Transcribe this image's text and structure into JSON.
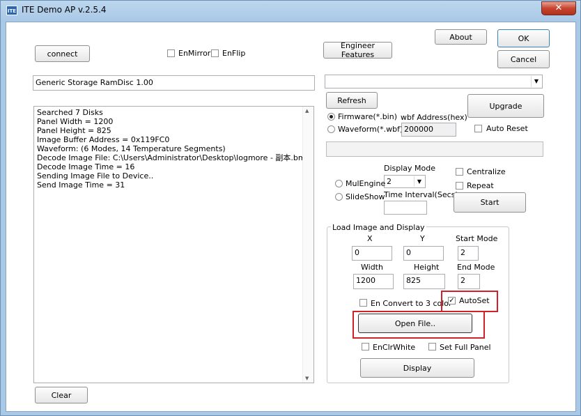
{
  "window": {
    "title": "ITE Demo AP v.2.5.4",
    "app_icon_text": "ITE",
    "close_glyph": "✕"
  },
  "buttons": {
    "connect": "connect",
    "engineer_features": "Engineer Features",
    "about": "About",
    "ok": "OK",
    "cancel": "Cancel",
    "refresh": "Refresh",
    "upgrade": "Upgrade",
    "start": "Start",
    "open_file": "Open File..",
    "display": "Display",
    "clear": "Clear"
  },
  "checkboxes": {
    "en_mirror": {
      "label": "EnMirror",
      "checked": false
    },
    "en_flip": {
      "label": "EnFlip",
      "checked": false
    },
    "auto_reset": {
      "label": "Auto Reset",
      "checked": false
    },
    "centralize": {
      "label": "Centralize",
      "checked": false
    },
    "repeat": {
      "label": "Repeat",
      "checked": false
    },
    "en_convert": {
      "label": "En Convert to 3 color",
      "checked": false
    },
    "autoset": {
      "label": "AutoSet",
      "checked": true
    },
    "en_clr_white": {
      "label": "EnClrWhite",
      "checked": false
    },
    "set_full_panel": {
      "label": "Set Full Panel",
      "checked": false
    }
  },
  "radios": {
    "firmware": {
      "label": "Firmware(*.bin)",
      "selected": true
    },
    "waveform": {
      "label": "Waveform(*.wbf)",
      "selected": false
    },
    "mul_engine": {
      "label": "MulEngine",
      "selected": false
    },
    "slide_show": {
      "label": "SlideShow",
      "selected": false
    }
  },
  "device_field": "Generic Storage RamDisc 1.00",
  "firmware_combo": "",
  "wbf_address": {
    "label": "wbf Address(hex)",
    "value": "200000"
  },
  "display_mode": {
    "label": "Display Mode",
    "value": "2"
  },
  "time_interval": {
    "label": "Time Interval(Secs)",
    "value": ""
  },
  "load_group": {
    "title": "Load Image and Display",
    "x": {
      "label": "X",
      "value": "0"
    },
    "y": {
      "label": "Y",
      "value": "0"
    },
    "start_mode": {
      "label": "Start Mode",
      "value": "2"
    },
    "width": {
      "label": "Width",
      "value": "1200"
    },
    "height": {
      "label": "Height",
      "value": "825"
    },
    "end_mode": {
      "label": "End Mode",
      "value": "2"
    }
  },
  "log_lines": [
    "Searched 7 Disks",
    "Panel Width = 1200",
    "Panel Height = 825",
    "Image Buffer Address = 0x119FC0",
    "Waveform: (6 Modes, 14 Temperature Segments)",
    "Decode Image File: C:\\Users\\Administrator\\Desktop\\logmore - 副本.bmp",
    "Decode Image Time = 16",
    "Sending Image File to Device..",
    "Send Image Time = 31"
  ],
  "glyphs": {
    "check": "✓",
    "combo_arrow": "▼",
    "scroll_up": "▲",
    "scroll_down": "▼"
  },
  "colors": {
    "highlight_red": "#d0202a",
    "title_bar": "#bcd7ee"
  }
}
